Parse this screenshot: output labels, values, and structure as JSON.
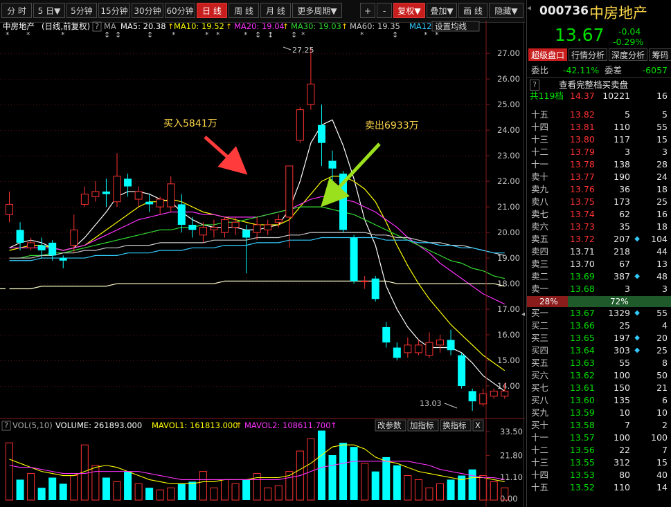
{
  "toolbar": {
    "periods": [
      "分 时",
      "5 日▼",
      "5分钟",
      "15分钟",
      "30分钟",
      "60分钟",
      "日 线",
      "周 线",
      "月 线",
      "更多周期▼"
    ],
    "active_period": "日 线",
    "plus": "+",
    "minus": "-",
    "fuquan": "复权▼",
    "diejia": "叠加▼",
    "huaxian": "画 线",
    "yincang": "隐藏▼"
  },
  "info_bar": {
    "name": "中房地产",
    "mode": "(日线,前复权)",
    "q": "?",
    "ma_label": "MA",
    "ma": [
      {
        "label": "MA5: 20.38",
        "color": "#ffffff"
      },
      {
        "label": "MA10: 19.52",
        "color": "#ffff00"
      },
      {
        "label": "MA20: 19.04",
        "color": "#ff33ff"
      },
      {
        "label": "MA30: 19.03",
        "color": "#33dd33"
      },
      {
        "label": "MA60: 19.35",
        "color": "#cccccc"
      },
      {
        "label": "MA12",
        "color": "#33ccff"
      }
    ],
    "dropdown": "设置均线"
  },
  "annotations": {
    "buy": "买入5841万",
    "sell": "卖出6933万",
    "high": "27.25",
    "low": "13.03"
  },
  "vol_bar": {
    "q": "?",
    "label": "VOL(5,10)",
    "volume": "VOLUME: 261893.000",
    "mavol1": "MAVOL1: 161813.000",
    "mavol2": "MAVOL2: 108611.700",
    "buttons": [
      "改参数",
      "加指标",
      "换指标"
    ],
    "close": "X",
    "axis": [
      "33.50",
      "21.80",
      "11.10",
      "0.00"
    ]
  },
  "chart_data": {
    "type": "candlestick",
    "price_axis": [
      "27.00",
      "26.00",
      "25.00",
      "24.00",
      "23.00",
      "22.00",
      "21.00",
      "20.00",
      "19.00",
      "18.00",
      "17.00",
      "16.00",
      "15.00",
      "14.00"
    ],
    "ylim": [
      13.0,
      27.6
    ],
    "candles": [
      {
        "o": 20.7,
        "c": 21.1,
        "h": 21.6,
        "l": 20.4
      },
      {
        "o": 20.1,
        "c": 19.6,
        "h": 20.4,
        "l": 19.3
      },
      {
        "o": 19.4,
        "c": 19.6,
        "h": 19.8,
        "l": 19.3
      },
      {
        "o": 19.5,
        "c": 19.3,
        "h": 19.8,
        "l": 19.0
      },
      {
        "o": 19.6,
        "c": 19.1,
        "h": 19.7,
        "l": 18.9
      },
      {
        "o": 19.0,
        "c": 18.9,
        "h": 19.1,
        "l": 18.6
      },
      {
        "o": 19.5,
        "c": 20.1,
        "h": 20.7,
        "l": 19.2
      },
      {
        "o": 21.1,
        "c": 21.5,
        "h": 21.8,
        "l": 21.0
      },
      {
        "o": 21.4,
        "c": 21.6,
        "h": 22.0,
        "l": 21.2
      },
      {
        "o": 21.6,
        "c": 21.5,
        "h": 22.1,
        "l": 21.0
      },
      {
        "o": 21.2,
        "c": 22.2,
        "h": 23.1,
        "l": 21.0
      },
      {
        "o": 22.1,
        "c": 21.8,
        "h": 22.3,
        "l": 21.4
      },
      {
        "o": 21.3,
        "c": 21.6,
        "h": 21.8,
        "l": 21.0
      },
      {
        "o": 21.2,
        "c": 21.1,
        "h": 21.5,
        "l": 20.8
      },
      {
        "o": 21.0,
        "c": 21.3,
        "h": 21.4,
        "l": 20.7
      },
      {
        "o": 21.0,
        "c": 21.9,
        "h": 22.2,
        "l": 20.8
      },
      {
        "o": 21.1,
        "c": 20.3,
        "h": 21.5,
        "l": 20.0
      },
      {
        "o": 20.3,
        "c": 20.1,
        "h": 20.6,
        "l": 19.8
      },
      {
        "o": 19.9,
        "c": 20.2,
        "h": 20.4,
        "l": 19.6
      },
      {
        "o": 20.1,
        "c": 20.2,
        "h": 20.5,
        "l": 19.8
      },
      {
        "o": 20.0,
        "c": 20.5,
        "h": 20.6,
        "l": 19.8
      },
      {
        "o": 20.2,
        "c": 20.4,
        "h": 20.6,
        "l": 19.9
      },
      {
        "o": 20.1,
        "c": 19.8,
        "h": 20.3,
        "l": 18.4
      },
      {
        "o": 20.0,
        "c": 20.3,
        "h": 20.6,
        "l": 19.7
      },
      {
        "o": 20.1,
        "c": 20.3,
        "h": 20.5,
        "l": 19.9
      },
      {
        "o": 20.4,
        "c": 20.5,
        "h": 20.7,
        "l": 20.2
      },
      {
        "o": 20.6,
        "c": 22.6,
        "h": 22.6,
        "l": 19.4
      },
      {
        "o": 23.6,
        "c": 24.8,
        "h": 24.9,
        "l": 23.5
      },
      {
        "o": 25.0,
        "c": 25.8,
        "h": 27.25,
        "l": 24.8
      },
      {
        "o": 24.2,
        "c": 23.5,
        "h": 25.0,
        "l": 22.6
      },
      {
        "o": 22.8,
        "c": 22.5,
        "h": 23.2,
        "l": 22.0
      },
      {
        "o": 22.3,
        "c": 20.1,
        "h": 22.4,
        "l": 20.0
      },
      {
        "o": 19.8,
        "c": 18.1,
        "h": 19.9,
        "l": 18.0
      },
      {
        "o": 18.1,
        "c": 18.1,
        "h": 18.3,
        "l": 17.8
      },
      {
        "o": 18.2,
        "c": 17.4,
        "h": 18.3,
        "l": 17.3
      },
      {
        "o": 16.3,
        "c": 15.7,
        "h": 16.5,
        "l": 15.5
      },
      {
        "o": 15.5,
        "c": 15.1,
        "h": 15.7,
        "l": 15.0
      },
      {
        "o": 15.3,
        "c": 15.6,
        "h": 15.9,
        "l": 15.1
      },
      {
        "o": 15.3,
        "c": 15.6,
        "h": 15.8,
        "l": 15.2
      },
      {
        "o": 15.2,
        "c": 15.7,
        "h": 16.1,
        "l": 15.1
      },
      {
        "o": 15.6,
        "c": 15.8,
        "h": 16.0,
        "l": 15.3
      },
      {
        "o": 15.8,
        "c": 15.4,
        "h": 16.2,
        "l": 15.2
      },
      {
        "o": 15.2,
        "c": 14.0,
        "h": 15.3,
        "l": 13.9
      },
      {
        "o": 13.8,
        "c": 13.4,
        "h": 13.9,
        "l": 13.03
      },
      {
        "o": 13.3,
        "c": 13.7,
        "h": 13.9,
        "l": 13.2
      },
      {
        "o": 13.6,
        "c": 13.8,
        "h": 13.9,
        "l": 13.5
      },
      {
        "o": 13.6,
        "c": 13.8,
        "h": 14.1,
        "l": 13.5
      }
    ],
    "ma_series": [
      {
        "name": "MA5",
        "color": "#ffffff",
        "values": [
          19.4,
          19.6,
          19.7,
          19.6,
          19.4,
          19.3,
          19.4,
          19.8,
          20.3,
          20.8,
          21.4,
          21.6,
          21.6,
          21.5,
          21.3,
          21.2,
          20.8,
          20.5,
          20.3,
          20.2,
          20.2,
          20.2,
          20.1,
          20.1,
          20.2,
          20.3,
          20.9,
          22.0,
          23.5,
          24.2,
          24.4,
          23.4,
          22.1,
          20.5,
          19.5,
          17.9,
          17.0,
          16.3,
          15.8,
          15.5,
          15.5,
          15.5,
          15.3,
          14.9,
          14.4,
          14.1,
          13.8
        ]
      },
      {
        "name": "MA10",
        "color": "#ffff00",
        "values": [
          19.3,
          19.4,
          19.5,
          19.5,
          19.4,
          19.3,
          19.4,
          19.5,
          19.8,
          20.1,
          20.4,
          20.7,
          21.0,
          21.2,
          21.2,
          21.3,
          21.2,
          21.0,
          20.8,
          20.7,
          20.6,
          20.5,
          20.4,
          20.3,
          20.3,
          20.3,
          20.5,
          21.0,
          21.5,
          22.0,
          22.2,
          22.2,
          22.0,
          21.7,
          21.2,
          20.4,
          19.5,
          18.7,
          18.0,
          17.4,
          16.9,
          16.4,
          16.0,
          15.6,
          15.2,
          14.9,
          14.6
        ]
      },
      {
        "name": "MA20",
        "color": "#ff33ff",
        "values": [
          19.4,
          19.4,
          19.4,
          19.4,
          19.4,
          19.3,
          19.4,
          19.5,
          19.7,
          19.9,
          20.1,
          20.3,
          20.5,
          20.6,
          20.7,
          20.8,
          20.8,
          20.8,
          20.7,
          20.7,
          20.6,
          20.6,
          20.6,
          20.6,
          20.7,
          20.8,
          20.9,
          21.1,
          21.3,
          21.4,
          21.4,
          21.3,
          21.2,
          21.0,
          20.8,
          20.5,
          20.2,
          19.8,
          19.5,
          19.2,
          18.8,
          18.5,
          18.2,
          17.9,
          17.6,
          17.4,
          17.2
        ]
      },
      {
        "name": "MA30",
        "color": "#33dd33",
        "values": [
          19.0,
          19.0,
          19.1,
          19.1,
          19.2,
          19.2,
          19.3,
          19.4,
          19.5,
          19.6,
          19.7,
          19.8,
          19.9,
          20.0,
          20.1,
          20.1,
          20.2,
          20.2,
          20.3,
          20.3,
          20.4,
          20.4,
          20.5,
          20.6,
          20.7,
          20.8,
          20.9,
          21.0,
          21.0,
          21.0,
          20.9,
          20.8,
          20.7,
          20.5,
          20.3,
          20.1,
          19.9,
          19.7,
          19.5,
          19.3,
          19.1,
          18.9,
          18.8,
          18.6,
          18.5,
          18.3,
          18.2
        ]
      },
      {
        "name": "MA60",
        "color": "#cccccc",
        "values": [
          19.0,
          19.0,
          19.0,
          19.1,
          19.1,
          19.2,
          19.2,
          19.3,
          19.3,
          19.4,
          19.4,
          19.5,
          19.5,
          19.5,
          19.6,
          19.6,
          19.6,
          19.6,
          19.6,
          19.7,
          19.7,
          19.7,
          19.7,
          19.8,
          19.8,
          19.8,
          19.9,
          19.9,
          20.0,
          20.0,
          20.0,
          20.0,
          20.0,
          20.0,
          19.9,
          19.9,
          19.8,
          19.8,
          19.7,
          19.6,
          19.6,
          19.5,
          19.5,
          19.4,
          19.3,
          19.2,
          19.1
        ]
      },
      {
        "name": "MA120",
        "color": "#33ccff",
        "values": [
          18.9,
          18.9,
          18.9,
          19.0,
          19.0,
          19.0,
          19.0,
          19.0,
          19.1,
          19.1,
          19.1,
          19.2,
          19.2,
          19.2,
          19.3,
          19.3,
          19.3,
          19.4,
          19.4,
          19.4,
          19.5,
          19.5,
          19.5,
          19.6,
          19.6,
          19.6,
          19.7,
          19.7,
          19.7,
          19.8,
          19.8,
          19.8,
          19.8,
          19.8,
          19.8,
          19.7,
          19.7,
          19.7,
          19.6,
          19.6,
          19.5,
          19.5,
          19.4,
          19.4,
          19.3,
          19.2,
          19.2
        ]
      },
      {
        "name": "MA250",
        "color": "#ffffcc",
        "values": [
          17.8,
          17.8,
          17.8,
          17.9,
          17.9,
          17.9,
          17.9,
          17.9,
          17.9,
          17.9,
          18.0,
          18.0,
          18.0,
          18.0,
          18.0,
          18.0,
          18.0,
          18.0,
          18.0,
          18.0,
          18.1,
          18.1,
          18.1,
          18.1,
          18.1,
          18.1,
          18.1,
          18.1,
          18.1,
          18.1,
          18.1,
          18.1,
          18.1,
          18.1,
          18.1,
          18.1,
          18.0,
          18.0,
          18.0,
          18.0,
          18.0,
          18.0,
          18.0,
          18.0,
          18.0,
          18.0,
          17.9
        ]
      }
    ],
    "volume": [
      28,
      10,
      13,
      6,
      11,
      8,
      12,
      27,
      17,
      11,
      9,
      14,
      8,
      6,
      5,
      6,
      8,
      9,
      14,
      6,
      10,
      8,
      10,
      13,
      6,
      7,
      14,
      24,
      30,
      34,
      22,
      28,
      26,
      18,
      14,
      21,
      17,
      12,
      10,
      6,
      8,
      10,
      12,
      15,
      12,
      9,
      6
    ],
    "vol_ylim": [
      0,
      33.5
    ],
    "mavol1": [
      20,
      18,
      16,
      14,
      13,
      12,
      12,
      14,
      16,
      17,
      16,
      14,
      12,
      10,
      9,
      8,
      8,
      8,
      9,
      9,
      10,
      10,
      10,
      11,
      11,
      11,
      12,
      15,
      18,
      22,
      26,
      27,
      27,
      25,
      21,
      19,
      18,
      16,
      14,
      13,
      12,
      11,
      10,
      11,
      11,
      10,
      9
    ],
    "mavol2": [
      17,
      16,
      16,
      15,
      14,
      13,
      13,
      13,
      14,
      14,
      14,
      14,
      14,
      13,
      12,
      11,
      10,
      10,
      10,
      10,
      10,
      10,
      10,
      10,
      10,
      10,
      11,
      12,
      14,
      16,
      17,
      18,
      19,
      19,
      19,
      19,
      19,
      19,
      18,
      17,
      15,
      14,
      13,
      12,
      11,
      11,
      10
    ]
  },
  "stock": {
    "code": "000736",
    "name": "中房地产",
    "price": "13.67",
    "change": "-0.04",
    "change_pct": "-0.29%"
  },
  "tabs": [
    "超级盘口",
    "行情分析",
    "深度分析",
    "筹码"
  ],
  "weibi": {
    "label1": "委比",
    "value1": "-42.11%",
    "label2": "委差",
    "value2": "-6057"
  },
  "ob_header": {
    "q": "?",
    "title": "查看完整档买卖盘"
  },
  "top_row": {
    "label": "共119档",
    "price": "14.37",
    "vol": "10221",
    "n": "16"
  },
  "asks": [
    {
      "label": "十五",
      "price": "13.82",
      "vol": "5",
      "n": "5",
      "dot": false
    },
    {
      "label": "十四",
      "price": "13.81",
      "vol": "110",
      "n": "55",
      "dot": false
    },
    {
      "label": "十三",
      "price": "13.80",
      "vol": "117",
      "n": "15",
      "dot": false
    },
    {
      "label": "十二",
      "price": "13.79",
      "vol": "3",
      "n": "3",
      "dot": false
    },
    {
      "label": "十一",
      "price": "13.78",
      "vol": "138",
      "n": "28",
      "dot": false
    },
    {
      "label": "卖十",
      "price": "13.77",
      "vol": "190",
      "n": "24",
      "dot": false
    },
    {
      "label": "卖九",
      "price": "13.76",
      "vol": "36",
      "n": "18",
      "dot": false
    },
    {
      "label": "卖八",
      "price": "13.75",
      "vol": "173",
      "n": "25",
      "dot": false
    },
    {
      "label": "卖七",
      "price": "13.74",
      "vol": "62",
      "n": "16",
      "dot": false
    },
    {
      "label": "卖六",
      "price": "13.73",
      "vol": "35",
      "n": "18",
      "dot": false
    },
    {
      "label": "卖五",
      "price": "13.72",
      "vol": "207",
      "n": "104",
      "dot": true
    },
    {
      "label": "卖四",
      "price": "13.71",
      "vol": "218",
      "n": "44",
      "dot": false
    },
    {
      "label": "卖三",
      "price": "13.70",
      "vol": "67",
      "n": "13",
      "dot": false
    },
    {
      "label": "卖二",
      "price": "13.69",
      "vol": "387",
      "n": "48",
      "dot": true
    },
    {
      "label": "卖一",
      "price": "13.68",
      "vol": "3",
      "n": "3",
      "dot": false
    }
  ],
  "ratio": {
    "left": "28%",
    "right": "72%",
    "left_frac": 0.28
  },
  "bids": [
    {
      "label": "买一",
      "price": "13.67",
      "vol": "1329",
      "n": "55",
      "dot": true
    },
    {
      "label": "买二",
      "price": "13.66",
      "vol": "25",
      "n": "4",
      "dot": false
    },
    {
      "label": "买三",
      "price": "13.65",
      "vol": "197",
      "n": "20",
      "dot": true
    },
    {
      "label": "买四",
      "price": "13.64",
      "vol": "303",
      "n": "25",
      "dot": true
    },
    {
      "label": "买五",
      "price": "13.63",
      "vol": "55",
      "n": "8",
      "dot": false
    },
    {
      "label": "买六",
      "price": "13.62",
      "vol": "100",
      "n": "50",
      "dot": false
    },
    {
      "label": "买七",
      "price": "13.61",
      "vol": "150",
      "n": "21",
      "dot": false
    },
    {
      "label": "买八",
      "price": "13.60",
      "vol": "135",
      "n": "6",
      "dot": false
    },
    {
      "label": "买九",
      "price": "13.59",
      "vol": "10",
      "n": "10",
      "dot": false
    },
    {
      "label": "买十",
      "price": "13.58",
      "vol": "7",
      "n": "2",
      "dot": false
    },
    {
      "label": "十一",
      "price": "13.57",
      "vol": "100",
      "n": "100",
      "dot": false
    },
    {
      "label": "十二",
      "price": "13.56",
      "vol": "22",
      "n": "7",
      "dot": false
    },
    {
      "label": "十三",
      "price": "13.55",
      "vol": "312",
      "n": "15",
      "dot": false
    },
    {
      "label": "十四",
      "price": "13.53",
      "vol": "80",
      "n": "40",
      "dot": false
    },
    {
      "label": "十五",
      "price": "13.52",
      "vol": "110",
      "n": "14",
      "dot": false
    }
  ],
  "colors": {
    "up": "#ff3232",
    "down": "#00ffff",
    "bid_green": "#00e000"
  }
}
